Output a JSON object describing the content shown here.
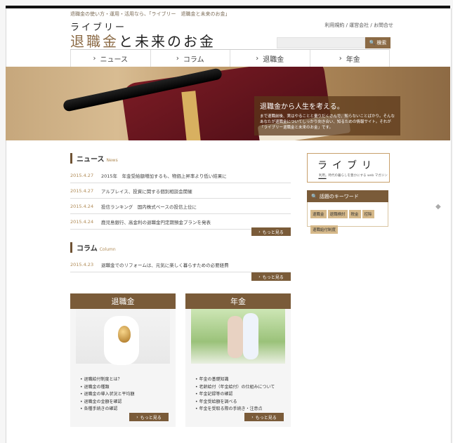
{
  "header": {
    "tagline": "退職金の使い方・運用・活用なら、「ライブリー　退職金と未来のお金」",
    "logo_top": "ライブリー",
    "logo_main_accent": "退職金",
    "logo_main_rest": "と未来のお金",
    "util_links": "利用規約 / 運営会社 / お問合せ",
    "search_placeholder": "",
    "search_button": "検索"
  },
  "nav": {
    "items": [
      {
        "label": "ニュース"
      },
      {
        "label": "コラム"
      },
      {
        "label": "退職金"
      },
      {
        "label": "年金"
      }
    ]
  },
  "hero": {
    "title": "退職金から人生を考える。",
    "text": "まで退職前後、実はやることと量りだくさんで、知らないことばかり。そんなあなたが退職金についてしっかり向き合い、知るための情報サイト。それが「ライブリー退職金と未来のお金」です。"
  },
  "news": {
    "title": "ニュース",
    "subtitle": "News",
    "items": [
      {
        "date": "2015.4.27",
        "text": "2015年　年金受給額増加するも、物価上昇率より低い結果に"
      },
      {
        "date": "2015.4.27",
        "text": "アルプレイス、投資に関する個別相談会開催"
      },
      {
        "date": "2015.4.24",
        "text": "投信ランキング　国内株式ベースの投信上位に"
      },
      {
        "date": "2015.4.24",
        "text": "鹿児島銀行、高金利の退職金円定期預金プランを発表"
      }
    ],
    "more": "もっと見る"
  },
  "column": {
    "title": "コラム",
    "subtitle": "Column",
    "items": [
      {
        "date": "2015.4.23",
        "text": "退職金でのリフォームは、元気に楽しく暮らすための必要経費"
      }
    ],
    "more": "もっと見る"
  },
  "sidebar": {
    "logo": "ライブリー",
    "logo_sub": "利用。時代の暮らしを豊かにする web マガジン",
    "keywords_title": "話題のキーワード",
    "keywords": [
      "退職金",
      "退職検討",
      "税金",
      "控除",
      "退職給付制度"
    ]
  },
  "cards": [
    {
      "title": "退職金",
      "items": [
        "退職給付制度とは？",
        "退職金の種類",
        "退職金の導入状況と平均額",
        "退職金の金額を確認",
        "各種手続きの確認"
      ],
      "more": "もっと見る"
    },
    {
      "title": "年金",
      "items": [
        "年金の基礎知識",
        "老齢給付（年金給付）の仕組みについて",
        "年金記録等の確認",
        "年金受給額を調べる",
        "年金を受取る際の手続き・注意点"
      ],
      "more": "もっと見る"
    }
  ],
  "colors": {
    "accent": "#7a5b39",
    "gold": "#b08b56"
  }
}
